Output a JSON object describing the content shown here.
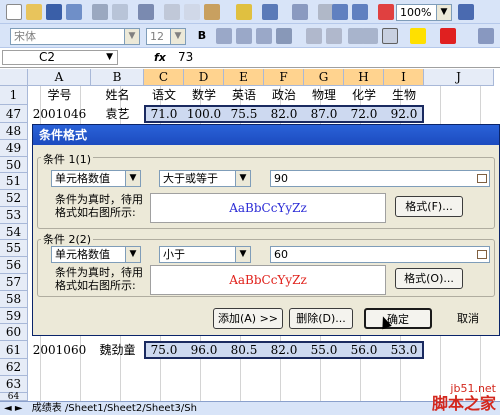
{
  "toolbar": {
    "zoom": "100%",
    "font_name": "宋体",
    "font_size": "12",
    "bold": "B"
  },
  "formula_bar": {
    "name_box": "C2",
    "fx": "fx",
    "value": "73"
  },
  "sheet": {
    "columns": [
      "A",
      "B",
      "C",
      "D",
      "E",
      "F",
      "G",
      "H",
      "I",
      "J"
    ],
    "row1": {
      "num": "1",
      "cells": [
        "学号",
        "姓名",
        "语文",
        "数学",
        "英语",
        "政治",
        "物理",
        "化学",
        "生物"
      ]
    },
    "row47": {
      "num": "47",
      "cells": [
        "2001046",
        "袁艺",
        "71.0",
        "100.0",
        "75.5",
        "82.0",
        "87.0",
        "72.0",
        "92.0"
      ]
    },
    "row61": {
      "num": "61",
      "cells": [
        "2001060",
        "魏劲童",
        "75.0",
        "96.0",
        "80.5",
        "82.0",
        "55.0",
        "56.0",
        "53.0"
      ]
    },
    "hidden_rows": [
      "48",
      "49",
      "50",
      "51",
      "52",
      "53",
      "54",
      "55",
      "56",
      "57",
      "58",
      "59",
      "60"
    ],
    "tail_rows": [
      "62",
      "63",
      "64"
    ]
  },
  "dialog": {
    "title": "条件格式",
    "cond1": {
      "label": "条件 1(1)",
      "type": "单元格数值",
      "operator": "大于或等于",
      "value": "90",
      "desc1": "条件为真时，待用",
      "desc2": "格式如右图所示:",
      "preview": "AaBbCcYyZz",
      "format_btn": "格式(F)..."
    },
    "cond2": {
      "label": "条件 2(2)",
      "type": "单元格数值",
      "operator": "小于",
      "value": "60",
      "desc1": "条件为真时，待用",
      "desc2": "格式如右图所示:",
      "preview": "AaBbCcYyZz",
      "format_btn": "格式(O)..."
    },
    "add_btn": "添加(A) >>",
    "delete_btn": "删除(D)...",
    "ok_btn": "确定",
    "cancel_btn": "取消"
  },
  "tabs": {
    "text": "成绩表 /Sheet1/Sheet2/Sheet3/Sh"
  },
  "watermark": {
    "line1": "jb51.net",
    "line2": "脚本之家"
  },
  "colors": {
    "toolbar_bg": "#d8e4f8",
    "title_blue": "#1c4bbf",
    "preview_blue": "#2b2bd6",
    "preview_red": "#e0201a",
    "watermark_red": "#d3271d"
  }
}
